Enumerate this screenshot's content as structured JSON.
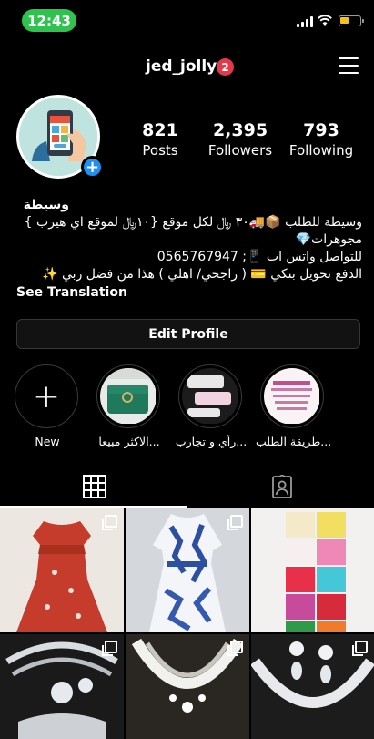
{
  "status_bar": {
    "time": "12:43"
  },
  "header": {
    "username": "jed_jolly",
    "notification_count": "2"
  },
  "stats": [
    {
      "value": "821",
      "label": "Posts"
    },
    {
      "value": "2,395",
      "label": "Followers"
    },
    {
      "value": "793",
      "label": "Following"
    }
  ],
  "bio": {
    "name": "وسيطة",
    "lines": [
      "وسيطة للطلب 📦🚚٣٠ ﷼ لكل موقع {١٠﷼ لموقع اي هيرب }",
      "مجوهرات💎",
      "للتواصل واتس اب 📱; 0565767947",
      "الدفع تحويل بنكي 💳 ( راجحي/ اهلي ) هذا من فضل ربي ✨"
    ],
    "see_translation": "See Translation"
  },
  "edit_profile_label": "Edit Profile",
  "highlights": [
    {
      "label": "New"
    },
    {
      "label": "الاكثر مبيعا..."
    },
    {
      "label": "رأي و تجارب..."
    },
    {
      "label": "طريقة الطلب..."
    }
  ],
  "tabs": {
    "grid": "grid-icon",
    "tagged": "tagged-icon"
  },
  "colors": {
    "accent": "#1f8ff0",
    "badge": "#e5384a",
    "time_pill": "#2ec24f"
  }
}
